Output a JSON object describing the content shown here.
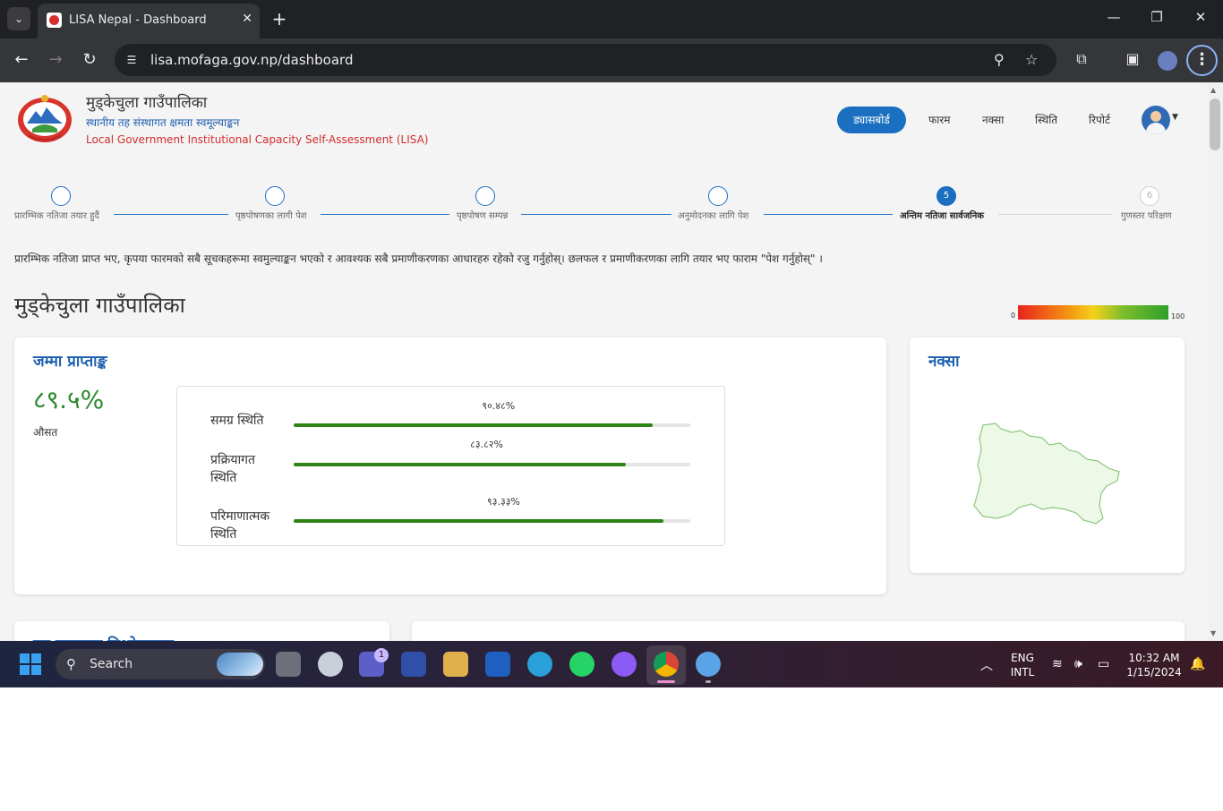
{
  "browser": {
    "tab_title": "LISA Nepal - Dashboard",
    "new_tab_label": "+",
    "url": "lisa.mofaga.gov.np/dashboard"
  },
  "header": {
    "municipality": "मुड्केचुला गाउँपालिका",
    "subtitle_np": "स्थानीय तह संस्थागत क्षमता स्वमूल्याङ्कन",
    "subtitle_en": "Local Government Institutional Capacity Self-Assessment (LISA)"
  },
  "nav": {
    "dashboard": "ड्यासबोर्ड",
    "form": "फारम",
    "map": "नक्सा",
    "status": "स्थिति",
    "report": "रिपोर्ट"
  },
  "stepper": [
    {
      "number": "",
      "label": "प्रारम्भिक नतिजा तयार हुदैं",
      "state": "done"
    },
    {
      "number": "",
      "label": "पृष्ठपोषणका लागी पेश",
      "state": "done"
    },
    {
      "number": "",
      "label": "पृष्ठपोषण सम्पन्न",
      "state": "done"
    },
    {
      "number": "",
      "label": "अनुमोदनका लागि पेश",
      "state": "done"
    },
    {
      "number": "5",
      "label": "अन्तिम नतिजा सार्वजनिक",
      "state": "active"
    },
    {
      "number": "6",
      "label": "गुणस्तर परिक्षण",
      "state": "pending"
    }
  ],
  "notice": "प्रारम्भिक नतिजा प्राप्त भए, कृपया फारमको सबै सूचकहरूमा स्वमुल्याङ्कन भएको र आवश्यक सबै प्रमाणीकरणका आधारहरु रहेको रजु गर्नुहोस्। छलफल र प्रमाणीकरणका लागि तयार भए फाराम \"पेश गर्नुहोस्\" ।",
  "main": {
    "heading": "मुड्केचुला गाउँपालिका",
    "legend": {
      "min_label": "0",
      "max_label": "100"
    },
    "total_card": {
      "title": "जम्मा प्राप्ताङ्क",
      "average_value": "८९.५%",
      "average_label": "औसत",
      "rows": [
        {
          "label_line1": "समग्र स्थिति",
          "label_line2": "",
          "value_text": "९०.४८%",
          "value": 90.48
        },
        {
          "label_line1": "प्रक्रियागत",
          "label_line2": "स्थिति",
          "value_text": "८३.८२%",
          "value": 83.82
        },
        {
          "label_line1": "परिमाणात्मक",
          "label_line2": "स्थिति",
          "value_text": "९३.३३%",
          "value": 93.33
        }
      ]
    },
    "map_card": {
      "title": "नक्सा"
    },
    "bottom_card_title": "उप मुल्याङ्कन विश्लेषणहरु"
  },
  "taskbar": {
    "search_label": "Search",
    "badge_count": "1",
    "lang_line1": "ENG",
    "lang_line2": "INTL",
    "time": "10:32 AM",
    "date": "1/15/2024"
  },
  "colors": {
    "accent_blue": "#1b6fc0",
    "progress_green": "#2e8414",
    "average_green": "#2c8a2c",
    "subtitle_red": "#d22d2d"
  },
  "icons": {
    "tab_menu": "chevron-down-icon",
    "back": "arrow-left-icon",
    "forward": "arrow-right-icon",
    "reload": "reload-icon",
    "zoom": "zoom-icon",
    "bookmark": "star-icon",
    "extensions": "puzzle-icon",
    "side_panel": "side-panel-icon",
    "menu": "kebab-icon"
  }
}
